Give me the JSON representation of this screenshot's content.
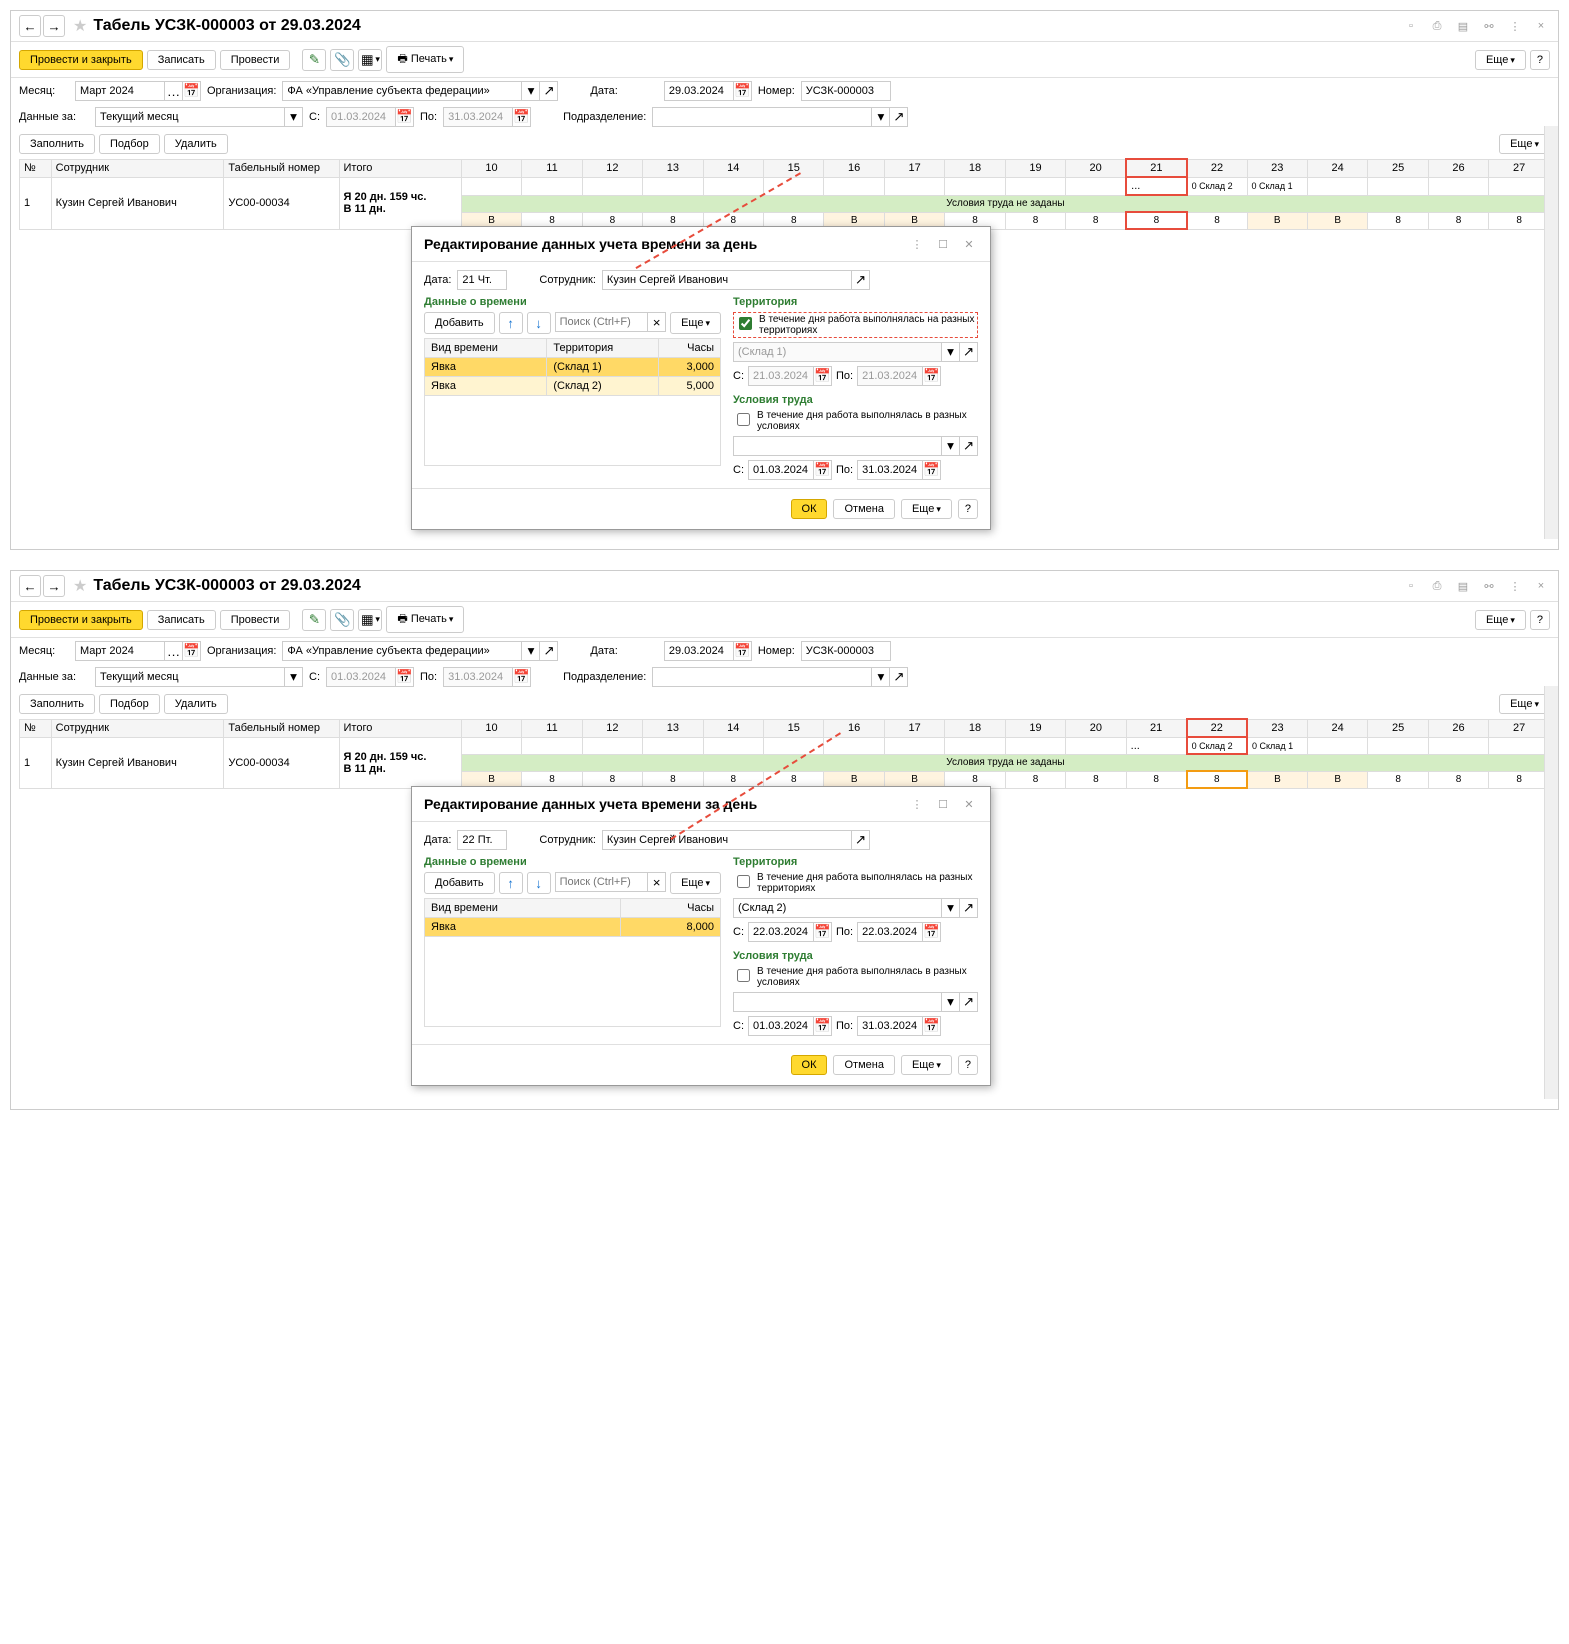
{
  "title": "Табель УСЗК-000003 от 29.03.2024",
  "toolbar": {
    "post_close": "Провести и закрыть",
    "write": "Записать",
    "post": "Провести",
    "print": "Печать",
    "more": "Еще"
  },
  "form": {
    "month_label": "Месяц:",
    "month_value": "Март 2024",
    "org_label": "Организация:",
    "org_value": "ФА «Управление субъекта федерации»",
    "date_label": "Дата:",
    "date_value": "29.03.2024",
    "number_label": "Номер:",
    "number_value": "УСЗК-000003",
    "data_for_label": "Данные за:",
    "data_for_value": "Текущий месяц",
    "period_c": "С:",
    "period_from": "01.03.2024",
    "period_to_lbl": "По:",
    "period_to": "31.03.2024",
    "subdiv_label": "Подразделение:"
  },
  "grid_toolbar": {
    "fill": "Заполнить",
    "pick": "Подбор",
    "delete": "Удалить",
    "more": "Еще"
  },
  "grid": {
    "col_no": "№",
    "col_emp": "Сотрудник",
    "col_tabno": "Табельный номер",
    "col_total": "Итого",
    "days": [
      "10",
      "11",
      "12",
      "13",
      "14",
      "15",
      "16",
      "17",
      "18",
      "19",
      "20",
      "21",
      "22",
      "23",
      "24",
      "25",
      "26",
      "27"
    ],
    "row1": {
      "no": "1",
      "emp": "Кузин Сергей Иванович",
      "tabno": "УС00-00034",
      "total": "Я 20 дн. 159 чс.\nВ 11 дн."
    },
    "cond_text": "Условия труда не заданы",
    "attend": [
      "В",
      "8",
      "8",
      "8",
      "8",
      "8",
      "В",
      "В",
      "8",
      "8",
      "8",
      "8",
      "8",
      "В",
      "В",
      "8",
      "8",
      "8"
    ],
    "cell21": "...",
    "cell22": "0 Склад 2",
    "cell23": "0 Склад 1"
  },
  "dlg1": {
    "title": "Редактирование данных учета времени за день",
    "date_lbl": "Дата:",
    "date_val": "21 Чт.",
    "emp_lbl": "Сотрудник:",
    "emp_val": "Кузин Сергей Иванович",
    "time_section": "Данные о времени",
    "add": "Добавить",
    "search_ph": "Поиск (Ctrl+F)",
    "more": "Еще",
    "col_type": "Вид времени",
    "col_terr": "Территория",
    "col_hours": "Часы",
    "r1_type": "Явка",
    "r1_terr": "(Склад 1)",
    "r1_hrs": "3,000",
    "r2_type": "Явка",
    "r2_terr": "(Склад 2)",
    "r2_hrs": "5,000",
    "terr_section": "Территория",
    "terr_chk": "В течение дня работа выполнялась на разных территориях",
    "terr_sel": "(Склад 1)",
    "terr_from": "21.03.2024",
    "terr_to": "21.03.2024",
    "cond_section": "Условия труда",
    "cond_chk": "В течение дня работа выполнялась в разных условиях",
    "cond_from": "01.03.2024",
    "cond_to": "31.03.2024",
    "c_lbl": "С:",
    "po_lbl": "По:",
    "ok": "ОК",
    "cancel": "Отмена"
  },
  "dlg2": {
    "title": "Редактирование данных учета времени за день",
    "date_val": "22 Пт.",
    "emp_val": "Кузин Сергей Иванович",
    "col_type": "Вид времени",
    "col_hours": "Часы",
    "r1_type": "Явка",
    "r1_hrs": "8,000",
    "terr_chk": "В течение дня работа выполнялась на разных территориях",
    "terr_sel": "(Склад 2)",
    "terr_from": "22.03.2024",
    "terr_to": "22.03.2024",
    "cond_from": "01.03.2024",
    "cond_to": "31.03.2024"
  },
  "question": "?"
}
